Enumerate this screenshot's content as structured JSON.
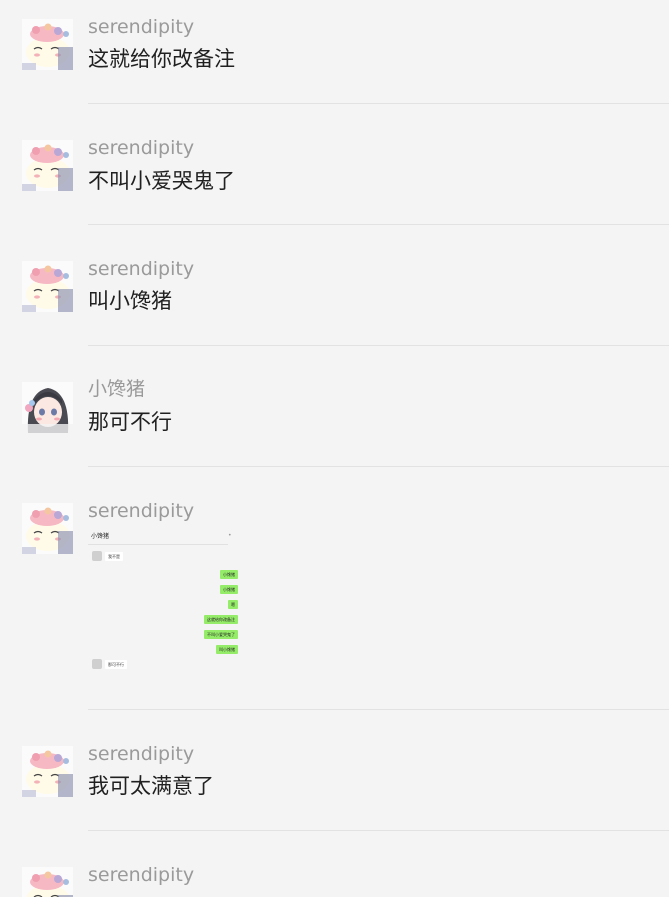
{
  "messages": [
    {
      "sender": "serendipity",
      "text": "这就给你改备注"
    },
    {
      "sender": "serendipity",
      "text": "不叫小爱哭鬼了"
    },
    {
      "sender": "serendipity",
      "text": "叫小馋猪"
    },
    {
      "sender": "小馋猪",
      "text": "那可不行"
    },
    {
      "sender": "serendipity",
      "image": {
        "chat_title": "小馋猪",
        "incoming_1": "我不是",
        "outgoing": [
          "小馋猪",
          "小馋猪",
          "嗯",
          "这就给你改备注",
          "不叫小爱哭鬼了",
          "叫小馋猪"
        ],
        "incoming_2": "那可不行"
      }
    },
    {
      "sender": "serendipity",
      "text": "我可太满意了"
    },
    {
      "sender": "serendipity",
      "text": ""
    }
  ],
  "colors": {
    "background": "#f4f4f4",
    "sender_name": "#9a9a9a",
    "message_text": "#202020",
    "divider": "#e2e2e2",
    "outgoing_bubble": "#95ec69"
  },
  "icons": {
    "avatar_serendipity": "cartoon-cat-with-flowers-avatar",
    "avatar_xiaochanzhu": "anime-girl-avatar"
  }
}
